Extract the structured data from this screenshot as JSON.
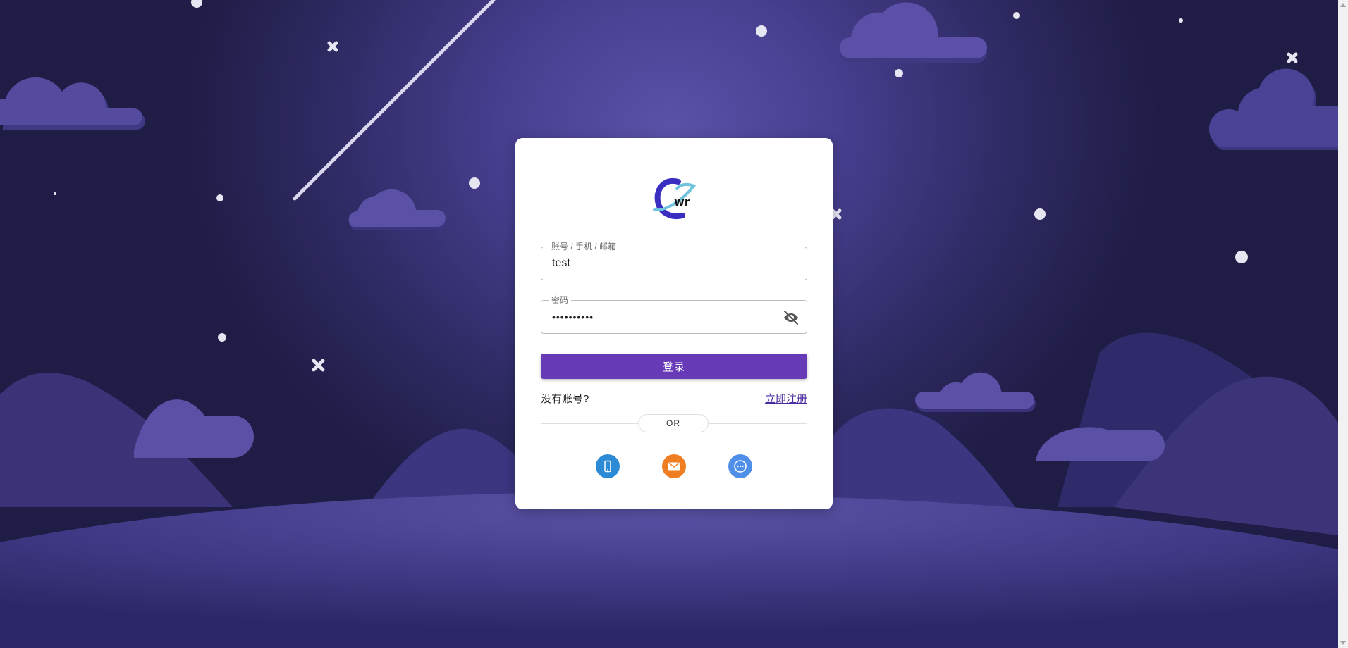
{
  "login": {
    "account_label": "账号 / 手机 / 邮箱",
    "account_value": "test",
    "password_label": "密码",
    "password_value": "••••••••••",
    "submit_label": "登录",
    "no_account_text": "没有账号?",
    "register_link": "立即注册",
    "divider_text": "OR"
  },
  "logo": {
    "text": "wr"
  },
  "social_logins": [
    {
      "icon": "phone-icon",
      "color": "#2d8bd6"
    },
    {
      "icon": "email-icon",
      "color": "#ef7d22"
    },
    {
      "icon": "message-icon",
      "color": "#4f8fe8"
    }
  ],
  "colors": {
    "primary": "#673ab7",
    "background": "#463e8e"
  }
}
